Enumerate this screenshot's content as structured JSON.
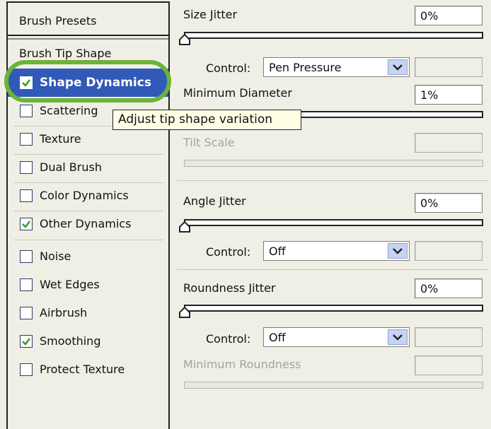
{
  "sidebar": {
    "presets_label": "Brush Presets",
    "tip_shape_label": "Brush Tip Shape",
    "items": [
      {
        "label": "Shape Dynamics",
        "checked": true,
        "selected": true
      },
      {
        "label": "Scattering",
        "checked": false
      },
      {
        "label": "Texture",
        "checked": false
      },
      {
        "label": "Dual Brush",
        "checked": false
      },
      {
        "label": "Color Dynamics",
        "checked": false
      },
      {
        "label": "Other Dynamics",
        "checked": true
      },
      {
        "label": "Noise",
        "checked": false
      },
      {
        "label": "Wet Edges",
        "checked": false
      },
      {
        "label": "Airbrush",
        "checked": false
      },
      {
        "label": "Smoothing",
        "checked": true
      },
      {
        "label": "Protect Texture",
        "checked": false
      }
    ]
  },
  "tooltip": "Adjust tip shape variation",
  "settings": {
    "size_jitter": {
      "label": "Size Jitter",
      "value": "0%",
      "level": 0
    },
    "size_control": {
      "label": "Control:",
      "value": "Pen Pressure"
    },
    "min_diameter": {
      "label": "Minimum Diameter",
      "value": "1%",
      "level": 0.01
    },
    "tilt_scale": {
      "label": "Tilt Scale",
      "value": ""
    },
    "angle_jitter": {
      "label": "Angle Jitter",
      "value": "0%",
      "level": 0
    },
    "angle_control": {
      "label": "Control:",
      "value": "Off"
    },
    "roundness_jitter": {
      "label": "Roundness Jitter",
      "value": "0%",
      "level": 0
    },
    "roundness_control": {
      "label": "Control:",
      "value": "Off"
    },
    "min_roundness": {
      "label": "Minimum Roundness",
      "value": ""
    }
  },
  "colors": {
    "selection": "#3159b8",
    "highlight_ring": "#6bb33a",
    "checkmark": "#3a9a2a"
  }
}
